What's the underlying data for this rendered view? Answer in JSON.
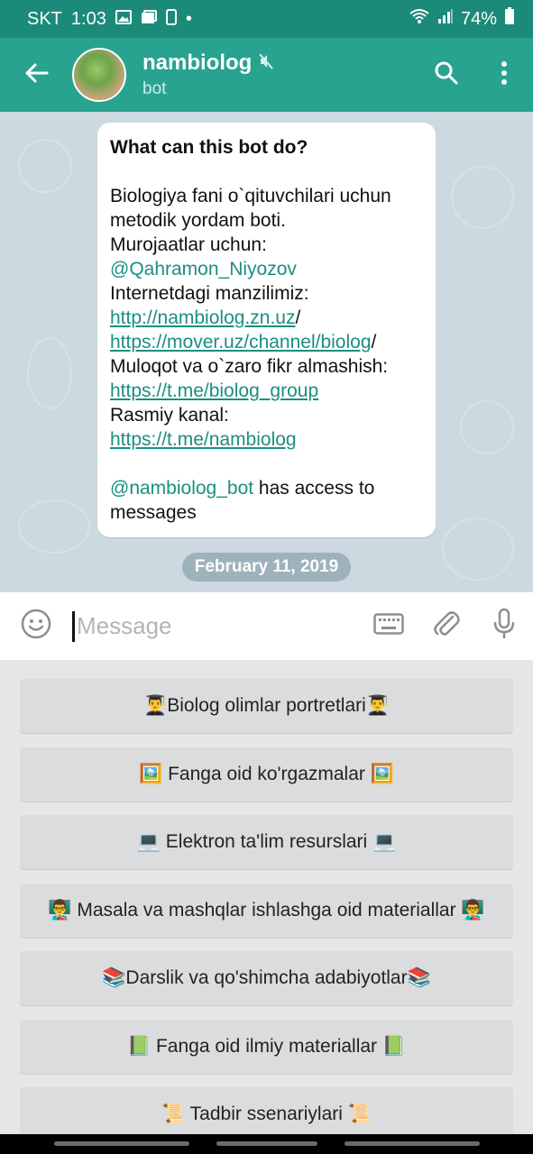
{
  "status_bar": {
    "carrier": "SKT",
    "time": "1:03",
    "dot": "•",
    "battery": "74%",
    "icons": [
      "image-icon",
      "gallery-icon",
      "notification-icon",
      "wifi-icon",
      "signal-icon",
      "battery-icon"
    ]
  },
  "header": {
    "title": "nambiolog",
    "subtitle": "bot",
    "icons": [
      "back-arrow-icon",
      "muted-icon",
      "search-icon",
      "more-vert-icon"
    ]
  },
  "chat": {
    "bot_info": {
      "heading": "What can this bot do?",
      "line1": "Biologiya fani o`qituvchilari uchun metodik yordam boti.",
      "line2": "Murojaatlar uchun:",
      "contact": "@Qahramon_Niyozov",
      "line3": "Internetdagi manzilimiz:",
      "link1": "http://nambiolog.zn.uz",
      "slash": "/",
      "link2": "https://mover.uz/channel/biolog",
      "line4": "Muloqot va o`zaro fikr almashish:",
      "link3": "https://t.me/biolog_group",
      "line5": "Rasmiy kanal:",
      "link4": "https://t.me/nambiolog",
      "bot_handle": "@nambiolog_bot",
      "access_text": " has access to messages"
    },
    "date_chip": "February 11, 2019"
  },
  "composer": {
    "placeholder": "Message",
    "icons": [
      "emoji-icon",
      "keyboard-icon",
      "attach-icon",
      "mic-icon"
    ]
  },
  "keyboard_buttons": [
    "👨‍🎓Biolog olimlar portretlari👨‍🎓",
    "🖼️ Fanga oid ko'rgazmalar 🖼️",
    "💻 Elektron ta'lim resurslari 💻",
    "👨‍🏫 Masala va mashqlar ishlashga oid materiallar 👨‍🏫",
    "📚Darslik va qo'shimcha adabiyotlar📚",
    "📗 Fanga oid ilmiy materiallar 📗",
    "📜 Tadbir ssenariylari 📜"
  ],
  "colors": {
    "status_bar": "#1b8a78",
    "app_bar": "#27a390",
    "chat_background": "#cdd9e0",
    "link": "#1a8f7f",
    "keyboard_button": "#dadcdd"
  }
}
